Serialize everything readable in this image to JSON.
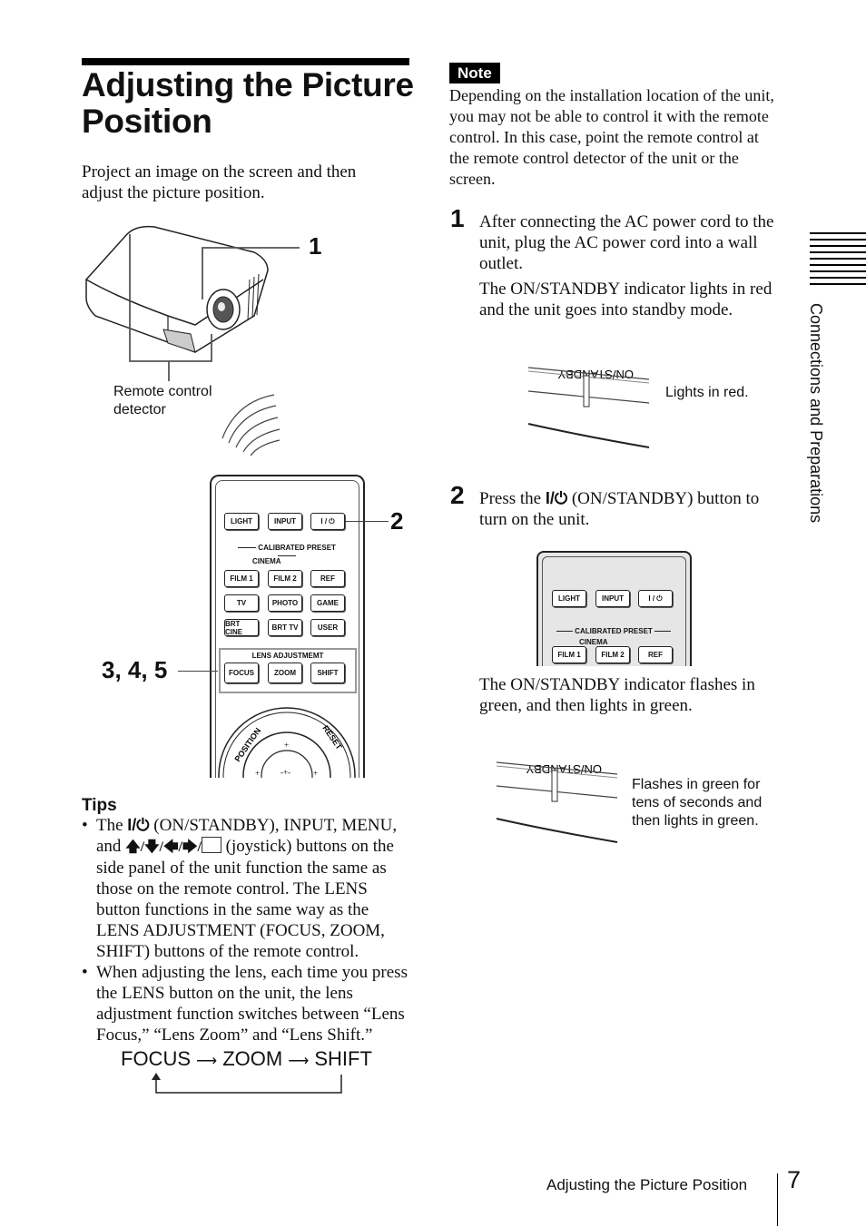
{
  "title": "Adjusting the Picture Position",
  "intro": "Project an image on the screen and then adjust the picture position.",
  "figure_projector": {
    "callout_1": "1",
    "label": "Remote control detector"
  },
  "remote": {
    "callout_2": "2",
    "callout_345": "3, 4, 5",
    "calibrated_preset": "CALIBRATED PRESET",
    "cinema": "CINEMA",
    "lens_adjustment": "LENS ADJUSTMEMT",
    "position": "POSITION",
    "reset": "RESET",
    "rows": [
      [
        "LIGHT",
        "INPUT",
        "I / ⏻"
      ],
      [
        "FILM 1",
        "FILM 2",
        "REF"
      ],
      [
        "TV",
        "PHOTO",
        "GAME"
      ],
      [
        "BRT CINE",
        "BRT TV",
        "USER"
      ],
      [
        "FOCUS",
        "ZOOM",
        "SHIFT"
      ]
    ]
  },
  "tips": {
    "heading": "Tips",
    "tip1": {
      "a": "The ",
      "power_symbol": "I/⏻",
      "b": " (ON/STANDBY), INPUT, MENU, and ",
      "arrows": "🡅/🡇/🡄/🡆/",
      "c": " (joystick) buttons on the side panel of the unit function the same as those on the remote control. The LENS button functions in the same way as the LENS ADJUSTMENT (FOCUS, ZOOM, SHIFT) buttons of the remote control."
    },
    "tip2": "When adjusting the lens, each time you press the LENS button on the unit, the lens adjustment function switches between “Lens Focus,” “Lens Zoom” and “Lens Shift.”",
    "cycle": [
      "FOCUS",
      "ZOOM",
      "SHIFT"
    ]
  },
  "note": {
    "badge": "Note",
    "text": "Depending on the installation location of the unit, you may not be able to control it with the remote control. In this case, point the remote control at the remote control detector of the unit or the screen."
  },
  "steps": [
    {
      "number": "1",
      "text": "After connecting the AC power cord to the unit, plug the AC power cord into a wall outlet.",
      "result": "The ON/STANDBY indicator lights in red and the unit goes into standby mode.",
      "indicator_label": "ON/STANDBY",
      "caption": "Lights in red."
    },
    {
      "number": "2",
      "text_a": "Press the ",
      "power_symbol": "I/⏻",
      "text_b": " (ON/STANDBY) button to turn on the unit.",
      "result": "The ON/STANDBY indicator flashes in green, and then lights in green.",
      "indicator_label": "ON/STANDBY",
      "caption": "Flashes in green for tens of seconds and then lights in green."
    }
  ],
  "sidebar": {
    "section": "Connections and Preparations"
  },
  "footer": {
    "running_title": "Adjusting the Picture Position",
    "page_number": "7"
  }
}
